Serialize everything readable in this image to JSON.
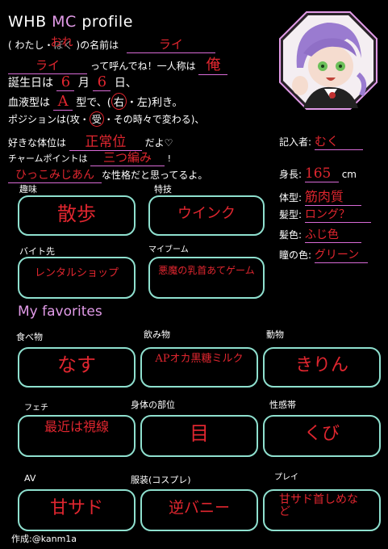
{
  "header": {
    "title_prefix": "WHB ",
    "title_accent": "MC",
    "title_suffix": " profile"
  },
  "intro": {
    "l1_open": "(",
    "l1_opt1": "わたし",
    "l1_dot": "・",
    "l1_opt2": "ぼく",
    "l1_written": "おれ",
    "l1_close": ")の名前は",
    "l1_value": "ライ",
    "l2_value": "ライ",
    "l2_text": "って呼んでね！一人称は",
    "l2_pronoun": "俺",
    "l3_text1": "誕生日は",
    "l3_month": "6",
    "l3_text2": "月",
    "l3_day": "6",
    "l3_text3": "日、",
    "l4_text1": "血液型は",
    "l4_blood": "A",
    "l4_text2": "型で、(",
    "l4_right": "右",
    "l4_dot": "・",
    "l4_left": "左",
    "l4_text3": ")利き。",
    "l5_text1": "ポジションは(",
    "l5_opt1": "攻",
    "l5_dot": "・",
    "l5_opt2": "受",
    "l5_dot2": "・",
    "l5_text2": "その時々で変わる)、",
    "l6_text1": "好きな体位は",
    "l6_value": "正常位",
    "l6_text2": "だよ♡",
    "l7_text1": "チャームポイントは",
    "l7_value": "三つ編み",
    "l7_text2": "!",
    "l8_value": "ひっこみじあん",
    "l8_text": "な性格だと思ってるよ。"
  },
  "writer": {
    "label": "記入者:",
    "value": "むく"
  },
  "stats": [
    {
      "label": "身長:",
      "value": "165",
      "unit": "cm"
    },
    {
      "label": "体型:",
      "value": "筋肉質"
    },
    {
      "label": "髪型:",
      "value": "ロング？"
    },
    {
      "label": "髪色:",
      "value": "ふじ色"
    },
    {
      "label": "瞳の色:",
      "value": "グリーン"
    }
  ],
  "profile_boxes": [
    {
      "label": "趣味",
      "value": "散歩"
    },
    {
      "label": "特技",
      "value": "ウインク"
    },
    {
      "label": "バイト先",
      "value": "レンタルショップ"
    },
    {
      "label": "マイブーム",
      "value": "悪魔の乳首あてゲーム"
    }
  ],
  "favorites_title": "My favorites",
  "favorites": [
    {
      "label": "食べ物",
      "value": "なす"
    },
    {
      "label": "飲み物",
      "value": "APオカ黒糖ミルク"
    },
    {
      "label": "動物",
      "value": "きりん"
    },
    {
      "label": "フェチ",
      "value": "最近は視線"
    },
    {
      "label": "身体の部位",
      "value": "目"
    },
    {
      "label": "性感帯",
      "value": "くび"
    },
    {
      "label": "AV",
      "value": "甘サド"
    },
    {
      "label": "服装(コスプレ)",
      "value": "逆バニー"
    },
    {
      "label": "プレイ",
      "value": "甘サド首しめなど"
    }
  ],
  "credit": "作成:@kanm1a"
}
